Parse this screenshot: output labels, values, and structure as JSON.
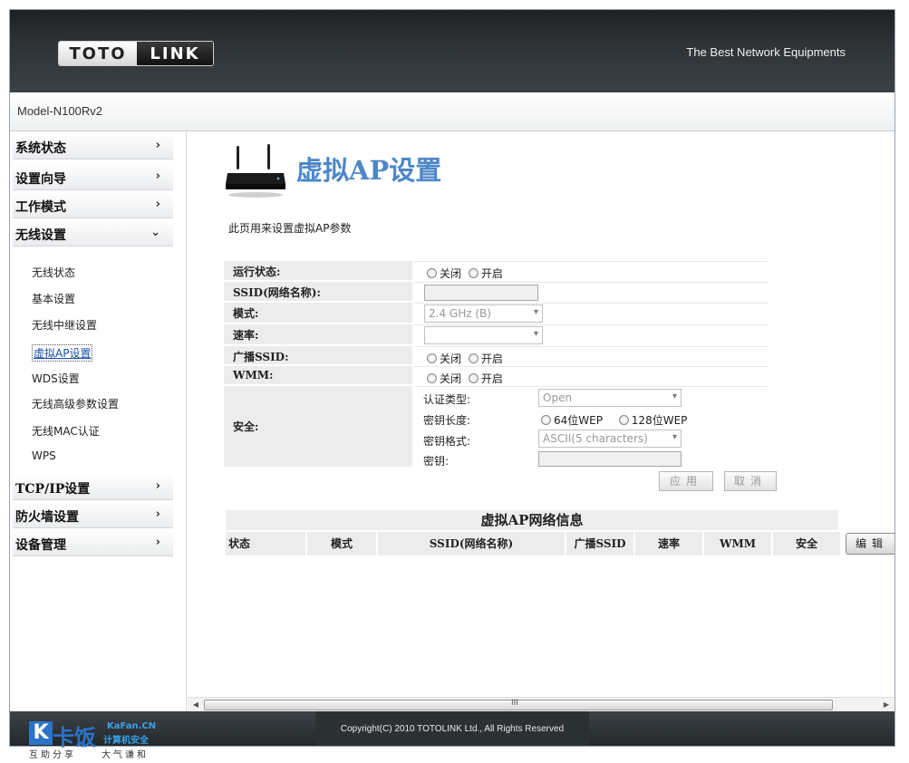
{
  "brand": {
    "logo_left": "TOTO",
    "logo_right": "LINK",
    "slogan": "The Best Network Equipments"
  },
  "model": "Model-N100Rv2",
  "sidebar": {
    "menus": [
      {
        "label": "系统状态",
        "arrow": "›"
      },
      {
        "label": "设置向导",
        "arrow": "›"
      },
      {
        "label": "工作模式",
        "arrow": "›"
      },
      {
        "label": "无线设置",
        "arrow": "⌄"
      },
      {
        "label": "TCP/IP设置",
        "arrow": "›"
      },
      {
        "label": "防火墙设置",
        "arrow": "›"
      },
      {
        "label": "设备管理",
        "arrow": "›"
      }
    ],
    "wireless_sub": [
      "无线状态",
      "基本设置",
      "无线中继设置",
      "虚拟AP设置",
      "WDS设置",
      "无线高级参数设置",
      "无线MAC认证",
      "WPS"
    ]
  },
  "page": {
    "title": "虚拟AP设置",
    "description": "此页用来设置虚拟AP参数"
  },
  "form": {
    "run_state_label": "运行状态:",
    "ssid_label": "SSID(网络名称):",
    "mode_label": "模式:",
    "mode_value": "2.4 GHz (B)",
    "rate_label": "速率:",
    "rate_value": "",
    "broadcast_label": "广播SSID:",
    "wmm_label": "WMM:",
    "security_label": "安全:",
    "off": "关闭",
    "on": "开启",
    "auth_type_label": "认证类型:",
    "auth_type_value": "Open",
    "key_length_label": "密钥长度:",
    "key_64": "64位WEP",
    "key_128": "128位WEP",
    "key_format_label": "密钥格式:",
    "key_format_value": "ASCII(5 characters)",
    "key_label": "密钥:",
    "apply": "应用",
    "cancel": "取消"
  },
  "ap_info": {
    "title": "虚拟AP网络信息",
    "columns": [
      "状态",
      "模式",
      "SSID(网络名称)",
      "广播SSID",
      "速率",
      "WMM",
      "安全"
    ],
    "edit": "编辑"
  },
  "footer": {
    "copyright": "Copyright(C) 2010 TOTOLINK Ltd.,   All Rights Reserved"
  },
  "watermark": {
    "brand": "卡饭",
    "site": "KaFan.CN",
    "tagline_cn": "计算机安全",
    "motto_left": "互助分享",
    "motto_right": "大气谦和"
  },
  "colors": {
    "title_blue": "#4d87c7",
    "header_dark": "#2d3236",
    "link_blue": "#1a4ea8"
  }
}
